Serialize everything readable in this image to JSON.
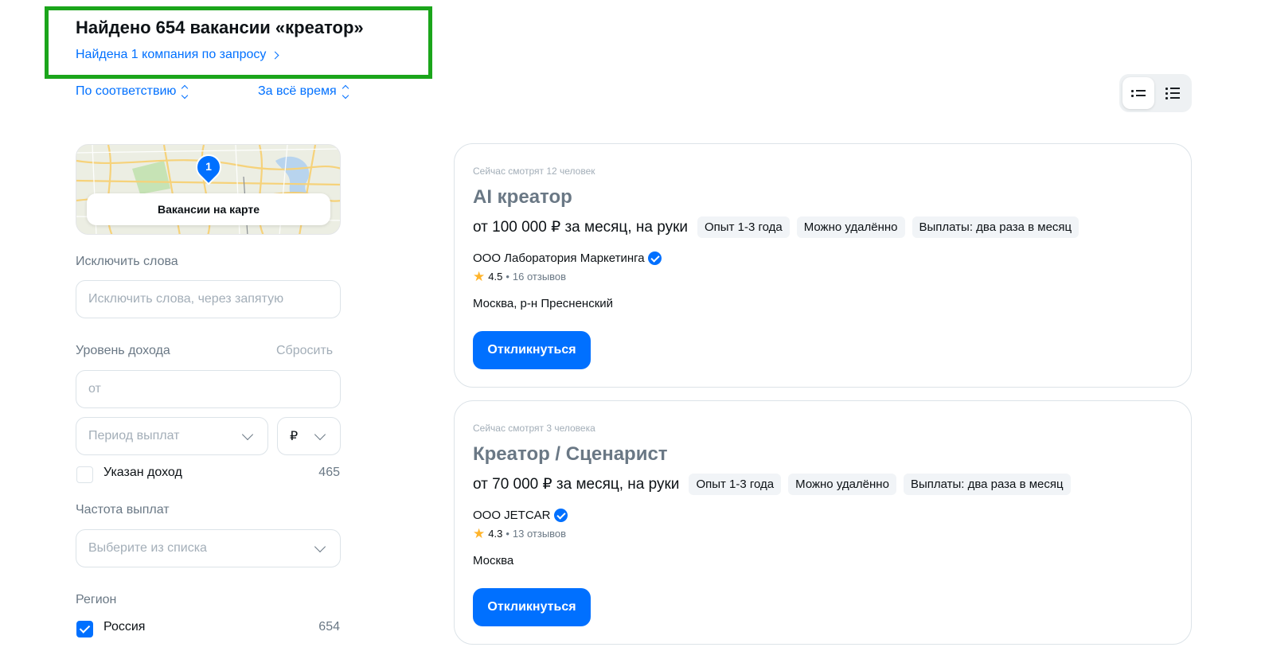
{
  "header": {
    "title": "Найдено 654 вакансии «креатор»",
    "company_link": "Найдена 1 компания по запросу",
    "sort_relevance": "По соответствию",
    "sort_period": "За всё время"
  },
  "map": {
    "button_label": "Вакансии на карте",
    "pin_count": "1"
  },
  "filters": {
    "exclude_words": {
      "title": "Исключить слова",
      "placeholder": "Исключить слова, через запятую"
    },
    "income": {
      "title": "Уровень дохода",
      "reset": "Сбросить",
      "from_placeholder": "от",
      "period_placeholder": "Период выплат",
      "currency": "₽",
      "income_specified_label": "Указан доход",
      "income_specified_count": "465"
    },
    "payment_frequency": {
      "title": "Частота выплат",
      "placeholder": "Выберите из списка"
    },
    "region": {
      "title": "Регион",
      "items": [
        {
          "label": "Россия",
          "count": "654",
          "checked": true
        }
      ]
    }
  },
  "vacancies": [
    {
      "watching": "Сейчас смотрят 12 человек",
      "title": "AI креатор",
      "salary": "от 100 000 ₽ за месяц, на руки",
      "tags": [
        "Опыт 1-3 года",
        "Можно удалённо",
        "Выплаты: два раза в месяц"
      ],
      "company": "ООО Лаборатория Маркетинга",
      "rating": "4.5",
      "reviews": "16 отзывов",
      "location": "Москва, р-н Пресненский",
      "apply_label": "Откликнуться"
    },
    {
      "watching": "Сейчас смотрят 3 человека",
      "title": "Креатор / Сценарист",
      "salary": "от 70 000 ₽ за месяц, на руки",
      "tags": [
        "Опыт 1-3 года",
        "Можно удалённо",
        "Выплаты: два раза в месяц"
      ],
      "company": "ООО JETCAR",
      "rating": "4.3",
      "reviews": "13 отзывов",
      "location": "Москва",
      "apply_label": "Откликнуться"
    }
  ],
  "colors": {
    "accent": "#0070ff",
    "highlight_border": "#1ba51b",
    "star": "#ffb42b"
  }
}
